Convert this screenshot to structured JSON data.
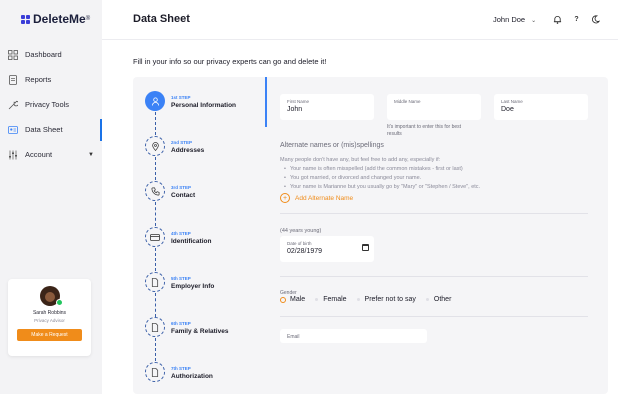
{
  "brand": {
    "name": "DeleteMe",
    "trademark": "®",
    "accent": "#3a3dd8"
  },
  "sidebar": {
    "items": [
      {
        "label": "Dashboard",
        "icon": "dashboard-icon",
        "active": false
      },
      {
        "label": "Reports",
        "icon": "report-icon",
        "active": false
      },
      {
        "label": "Privacy Tools",
        "icon": "wrench-icon",
        "active": false
      },
      {
        "label": "Data Sheet",
        "icon": "id-card-icon",
        "active": true
      },
      {
        "label": "Account",
        "icon": "settings-sliders-icon",
        "active": false,
        "has_dropdown": true
      }
    ],
    "profile": {
      "name": "Sarah Robbins",
      "role": "Privacy Advisor",
      "button_label": "Make a Request",
      "button_color": "#f08c1a"
    }
  },
  "header": {
    "title": "Data Sheet",
    "user_name": "John Doe",
    "icons": [
      "bell-icon",
      "help-icon",
      "dark-mode-icon"
    ]
  },
  "intro_text": "Fill in your info so our privacy experts can go and delete it!",
  "steps": [
    {
      "number": "1st STEP",
      "label": "Personal Information",
      "icon": "user-icon",
      "active": true
    },
    {
      "number": "2nd STEP",
      "label": "Addresses",
      "icon": "location-pin-icon",
      "active": false
    },
    {
      "number": "3rd STEP",
      "label": "Contact",
      "icon": "phone-icon",
      "active": false
    },
    {
      "number": "4th STEP",
      "label": "Identification",
      "icon": "credit-card-icon",
      "active": false
    },
    {
      "number": "5th STEP",
      "label": "Employer Info",
      "icon": "document-icon",
      "active": false
    },
    {
      "number": "6th STEP",
      "label": "Family & Relatives",
      "icon": "document-icon",
      "active": false
    },
    {
      "number": "7th STEP",
      "label": "Authorization",
      "icon": "document-icon",
      "active": false
    }
  ],
  "form": {
    "first_name": {
      "label": "First Name",
      "value": "John"
    },
    "middle_name": {
      "label": "Middle Name",
      "value": ""
    },
    "last_name": {
      "label": "Last Name",
      "value": "Doe"
    },
    "middle_hint": "It's important to enter this for best results",
    "alternate": {
      "title": "Alternate names or (mis)spellings",
      "intro": "Many people don't have any, but feel free to add any, especially if:",
      "bullets": [
        "Your name is often misspelled (add the common mistakes - first or last)",
        "You got married, or divorced and changed your name.",
        "Your name is Marianne but you usually go by \"Mary\" or \"Stephen / Steve\", etc."
      ],
      "add_label": "Add Alternate Name"
    },
    "age_text": "(44 years young)",
    "dob": {
      "label": "Date of birth",
      "value": "02/28/1979"
    },
    "gender": {
      "label": "Gender",
      "options": [
        "Male",
        "Female",
        "Prefer not to say",
        "Other"
      ],
      "selected": "Male"
    },
    "email": {
      "label": "Email",
      "value": ""
    }
  },
  "colors": {
    "primary": "#3b82f6",
    "orange": "#f08c1a",
    "panel": "#f5f5f7"
  }
}
